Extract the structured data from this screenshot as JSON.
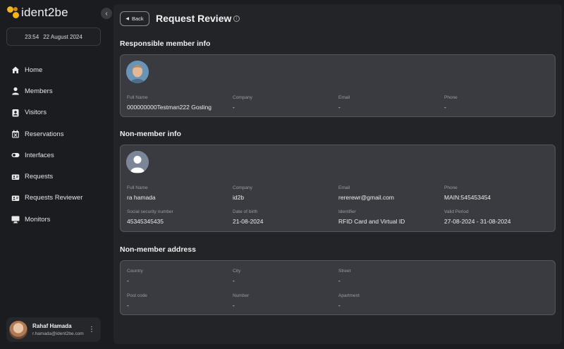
{
  "app": {
    "logo_text": "ident2be"
  },
  "sidebar": {
    "clock_time": "23:54",
    "clock_date": "22 August 2024",
    "items": [
      {
        "label": "Home",
        "icon": "home-icon"
      },
      {
        "label": "Members",
        "icon": "person-icon"
      },
      {
        "label": "Visitors",
        "icon": "badge-icon"
      },
      {
        "label": "Reservations",
        "icon": "calendar-icon"
      },
      {
        "label": "Interfaces",
        "icon": "toggle-icon"
      },
      {
        "label": "Requests",
        "icon": "ticket-icon"
      },
      {
        "label": "Requests Reviewer",
        "icon": "ticket-review-icon"
      },
      {
        "label": "Monitors",
        "icon": "monitor-icon"
      }
    ],
    "profile": {
      "name": "Rahaf Hamada",
      "email": "r.hamada@ident2be.com"
    }
  },
  "header": {
    "back_label": "Back",
    "title": "Request Review"
  },
  "responsible": {
    "title": "Responsible member info",
    "full_name_label": "Full Name",
    "full_name": "000000000Testman222 Gosling",
    "company_label": "Company",
    "company": "-",
    "email_label": "Email",
    "email": "-",
    "phone_label": "Phone",
    "phone": "-"
  },
  "non_member": {
    "title": "Non-member info",
    "full_name_label": "Full Name",
    "full_name": "ra hamada",
    "company_label": "Company",
    "company": "id2b",
    "email_label": "Email",
    "email": "rererewr@gmail.com",
    "phone_label": "Phone",
    "phone": "MAIN:545453454",
    "ssn_label": "Social security number",
    "ssn": "45345345435",
    "dob_label": "Date of birth",
    "dob": "21-08-2024",
    "identifier_label": "Identifier",
    "identifier": "RFID Card and Virtual ID",
    "valid_label": "Valid Period",
    "valid": "27-08-2024 - 31-08-2024"
  },
  "address": {
    "title": "Non-member address",
    "country_label": "Country",
    "country": "-",
    "city_label": "City",
    "city": "-",
    "street_label": "Street",
    "street": "-",
    "postcode_label": "Post code",
    "postcode": "-",
    "number_label": "Number",
    "number": "-",
    "apartment_label": "Apartment",
    "apartment": "-"
  }
}
